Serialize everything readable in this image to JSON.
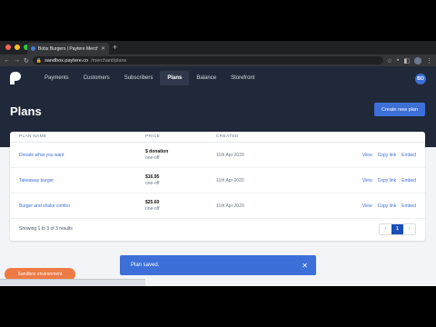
{
  "browser": {
    "tab_title": "Bobs Burgers | Paytere Merchant",
    "url_host": "sandbox.paytere.co",
    "url_path": "/merchant/plans"
  },
  "nav": {
    "items": [
      {
        "label": "Payments"
      },
      {
        "label": "Customers"
      },
      {
        "label": "Subscribers"
      },
      {
        "label": "Plans"
      },
      {
        "label": "Balance"
      },
      {
        "label": "Storefront"
      }
    ],
    "active": "Plans",
    "avatar_initials": "BO"
  },
  "page": {
    "title": "Plans",
    "new_plan_label": "Create new plan"
  },
  "table": {
    "headers": [
      "PLAN NAME",
      "PRICE",
      "CREATED"
    ],
    "rows": [
      {
        "name": "Donate what you want",
        "price": "$ donation",
        "type": "one-off",
        "created": "11th Apr 2020"
      },
      {
        "name": "Takeaway burger",
        "price": "$16.95",
        "type": "one-off",
        "created": "11th Apr 2020"
      },
      {
        "name": "Burger and shake combo",
        "price": "$25.60",
        "type": "one-off",
        "created": "11th Apr 2020"
      }
    ],
    "actions": [
      "View",
      "Copy link",
      "Embed"
    ],
    "footer_text": "Showing 1 to 3 of 3 results",
    "pagination": {
      "prev": "‹",
      "current": "1",
      "next": "›"
    }
  },
  "toast": {
    "message": "Plan saved.",
    "close": "✕"
  },
  "sandbox_pill": "Sandbox environment",
  "colors": {
    "accent": "#3d6fd8",
    "nav_bg": "#202939",
    "sandbox": "#ee7a45"
  }
}
